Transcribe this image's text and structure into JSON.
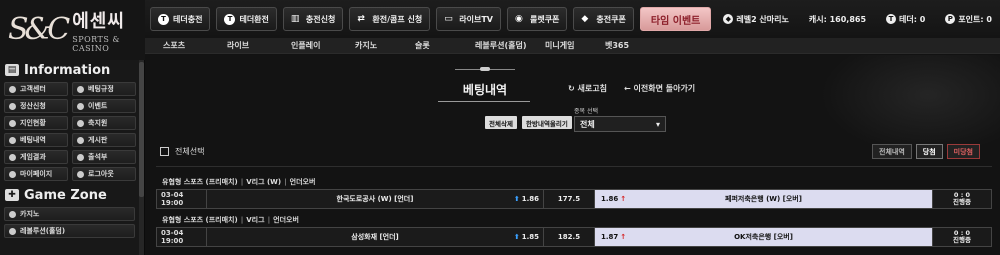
{
  "logo": {
    "mark": "S&C",
    "name": "에센씨",
    "sub": "SPORTS & CASINO"
  },
  "topbar": {
    "buttons": [
      {
        "label": "테더충전",
        "icon": "tether-icon"
      },
      {
        "label": "테더환전",
        "icon": "tether-icon"
      },
      {
        "label": "충전신청",
        "icon": "bank-icon"
      },
      {
        "label": "환전/콤프 신청",
        "icon": "exchange-icon"
      },
      {
        "label": "라이브TV",
        "icon": "tv-icon"
      },
      {
        "label": "룰렛쿠폰",
        "icon": "roulette-icon"
      },
      {
        "label": "충전쿠폰",
        "icon": "ticket-icon"
      }
    ],
    "event_label": "타임 이벤트",
    "level": "레벨2 산마리노",
    "cash": "캐시: 160,865",
    "tether": "테더: 0",
    "point": "포인트: 0",
    "comp": "콤프"
  },
  "subnav": [
    "스포츠",
    "라이브",
    "인플레이",
    "카지노",
    "슬롯",
    "레볼루션(홀덤)",
    "미니게임",
    "벳365"
  ],
  "sidebar": {
    "info_title": "Information",
    "info_items": [
      "고객센터",
      "베팅규정",
      "정산신청",
      "이벤트",
      "지인현황",
      "축지원",
      "베팅내역",
      "게시판",
      "게임결과",
      "출석부",
      "마이페이지",
      "로그아웃"
    ],
    "game_title": "Game Zone",
    "game_items": [
      "카지노",
      "레볼루션(홀덤)"
    ]
  },
  "main": {
    "title": "베팅내역",
    "refresh": "새로고침",
    "back": "이전화면 돌아가기",
    "delete_all": "전체삭제",
    "upload": "한방내역올리기",
    "select_label": "종목 선택",
    "select_value": "전체",
    "select_all": "전체선택",
    "filters": [
      "전체내역",
      "당첨",
      "미당첨"
    ]
  },
  "bets": [
    {
      "header": {
        "type": "유협형 스포츠 (프리매치)",
        "league": "V리그 (W)",
        "market": "언더오버"
      },
      "time": "03-04 19:00",
      "home": "한국도로공사 (W) [언더]",
      "home_odds": "1.86",
      "line": "177.5",
      "away_odds": "1.86",
      "away": "페퍼저축은행 (W) [오버]",
      "score": "0 : 0",
      "status": "진행중"
    },
    {
      "header": {
        "type": "유협형 스포츠 (프리매치)",
        "league": "V리그",
        "market": "언더오버"
      },
      "time": "03-04 19:00",
      "home": "삼성화재 [언더]",
      "home_odds": "1.85",
      "line": "182.5",
      "away_odds": "1.87",
      "away": "OK저축은행 [오버]",
      "score": "0 : 0",
      "status": "진행중"
    }
  ]
}
